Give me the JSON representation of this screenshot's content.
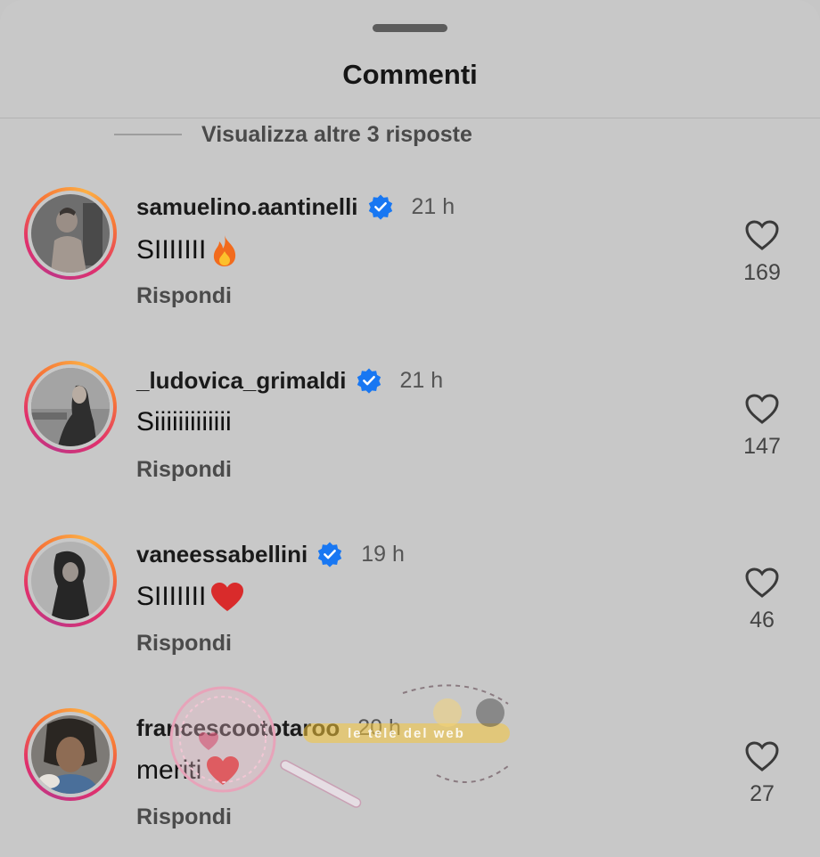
{
  "header": {
    "title": "Commenti"
  },
  "more_replies": "Visualizza altre 3 risposte",
  "comments": [
    {
      "username": "samuelino.aantinelli",
      "verified": true,
      "time": "21 h",
      "text": "SIIIIIII",
      "emoji": "fire-icon",
      "reply": "Rispondi",
      "likes": "169"
    },
    {
      "username": "_ludovica_grimaldi",
      "verified": true,
      "time": "21 h",
      "text": "Siiiiiiiiiiiii",
      "emoji": "",
      "reply": "Rispondi",
      "likes": "147"
    },
    {
      "username": "vaneessabellini",
      "verified": true,
      "time": "19 h",
      "text": "SIIIIIII",
      "emoji": "red-heart-icon",
      "reply": "Rispondi",
      "likes": "46"
    },
    {
      "username": "francescoototaroo",
      "verified": false,
      "time": "20 h",
      "text": "meriti",
      "emoji": "red-heart-icon",
      "reply": "Rispondi",
      "likes": "27"
    }
  ],
  "watermark": {
    "text": "le tele del web"
  },
  "colors": {
    "verified": "#1877f2",
    "heart": "#d92b2b",
    "fire": "#f26b1d"
  }
}
